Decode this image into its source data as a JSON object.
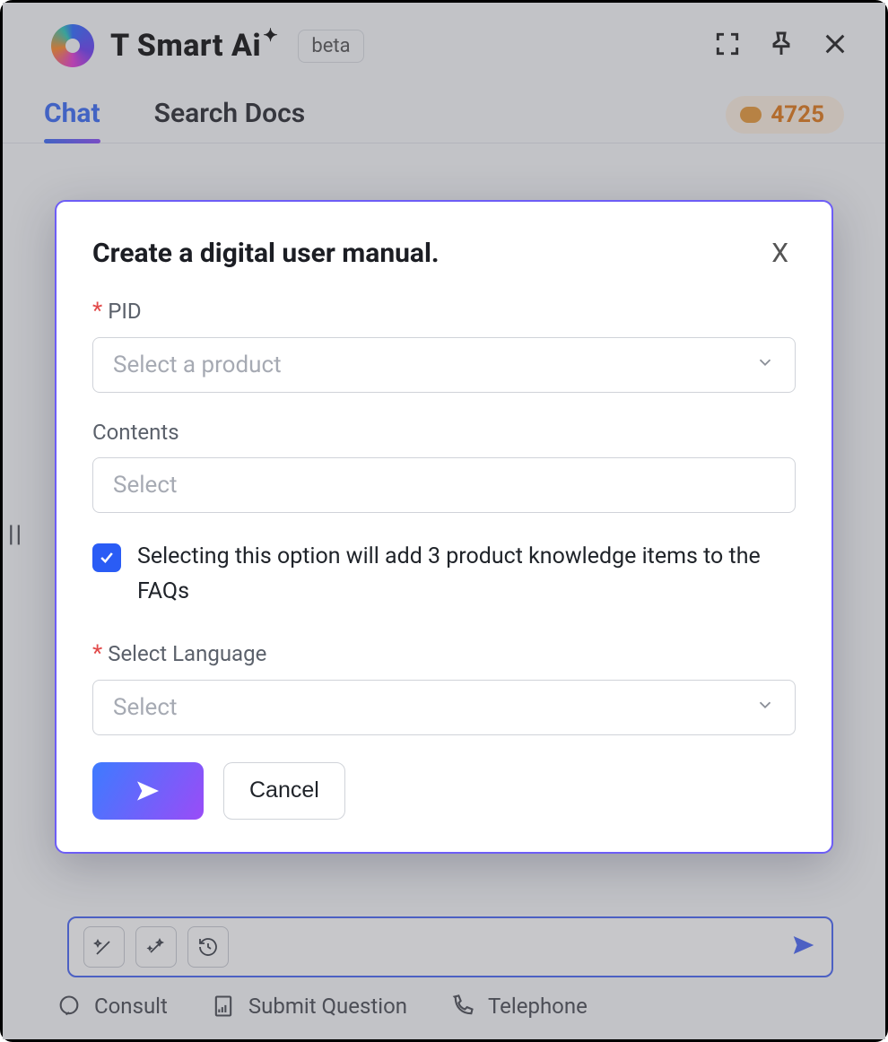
{
  "header": {
    "brand": "T Smart Ai",
    "beta_label": "beta"
  },
  "tabs": {
    "chat": "Chat",
    "docs": "Search Docs"
  },
  "points": "4725",
  "modal": {
    "title": "Create a digital user manual.",
    "pid_label": "PID",
    "pid_placeholder": "Select a product",
    "contents_label": "Contents",
    "contents_placeholder": "Select",
    "checkbox_text": "Selecting this option will add 3 product knowledge items to the FAQs",
    "language_label": "Select Language",
    "language_placeholder": "Select",
    "cancel_label": "Cancel"
  },
  "footer": {
    "consult": "Consult",
    "submit": "Submit Question",
    "telephone": "Telephone"
  }
}
